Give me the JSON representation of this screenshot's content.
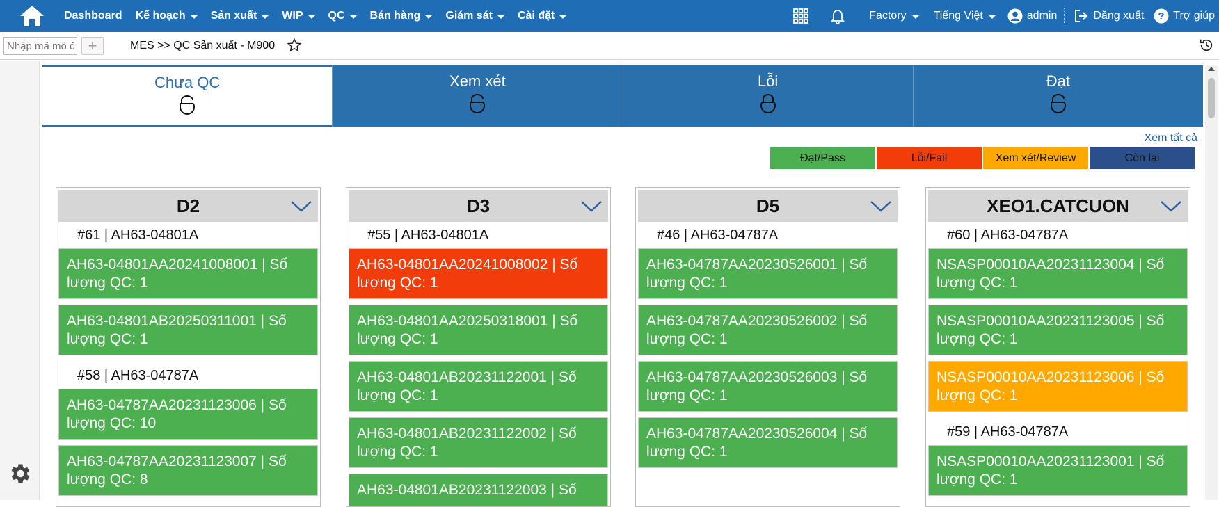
{
  "nav": {
    "items": [
      "Dashboard",
      "Kế hoạch",
      "Sản xuất",
      "WIP",
      "QC",
      "Bán hàng",
      "Giám sát",
      "Cài đặt"
    ],
    "factory": "Factory",
    "language": "Tiếng Việt",
    "user": "admin",
    "logout": "Đăng xuất",
    "help": "Trợ giúp"
  },
  "subbar": {
    "placeholder": "Nhập mã mô đ",
    "breadcrumb": "MES >> QC Sản xuất - M900"
  },
  "tabs": [
    {
      "label": "Chưa QC",
      "active": true
    },
    {
      "label": "Xem xét",
      "active": false
    },
    {
      "label": "Lỗi",
      "active": false
    },
    {
      "label": "Đạt",
      "active": false
    }
  ],
  "view_all": "Xem tất cả",
  "legend": [
    {
      "label": "Đạt/Pass",
      "color": "#4caf50"
    },
    {
      "label": "Lỗi/Fail",
      "color": "#f23c0a"
    },
    {
      "label": "Xem xét/Review",
      "color": "#ffa800"
    },
    {
      "label": "Còn lại",
      "color": "#2a4f8a"
    }
  ],
  "colors": {
    "pass": "#4caf50",
    "fail": "#f23c0a",
    "review": "#ffa800"
  },
  "columns": [
    {
      "title": "D2",
      "groups": [
        {
          "title": "#61 | AH63-04801A",
          "cards": [
            {
              "text": "AH63-04801AA20241008001 | Số lượng QC: 1",
              "status": "pass"
            },
            {
              "text": "AH63-04801AB20250311001 | Số lượng QC: 1",
              "status": "pass"
            }
          ]
        },
        {
          "title": "#58 | AH63-04787A",
          "cards": [
            {
              "text": "AH63-04787AA20231123006 | Số lượng QC: 10",
              "status": "pass"
            },
            {
              "text": "AH63-04787AA20231123007 | Số lượng QC: 8",
              "status": "pass"
            }
          ]
        }
      ]
    },
    {
      "title": "D3",
      "groups": [
        {
          "title": "#55 | AH63-04801A",
          "cards": [
            {
              "text": "AH63-04801AA20241008002 | Số lượng QC: 1",
              "status": "fail"
            },
            {
              "text": "AH63-04801AA20250318001 | Số lượng QC: 1",
              "status": "pass"
            },
            {
              "text": "AH63-04801AB20231122001 | Số lượng QC: 1",
              "status": "pass"
            },
            {
              "text": "AH63-04801AB20231122002 | Số lượng QC: 1",
              "status": "pass"
            },
            {
              "text": "AH63-04801AB20231122003 | Số",
              "status": "pass"
            }
          ]
        }
      ]
    },
    {
      "title": "D5",
      "groups": [
        {
          "title": "#46 | AH63-04787A",
          "cards": [
            {
              "text": "AH63-04787AA20230526001 | Số lượng QC: 1",
              "status": "pass"
            },
            {
              "text": "AH63-04787AA20230526002 | Số lượng QC: 1",
              "status": "pass"
            },
            {
              "text": "AH63-04787AA20230526003 | Số lượng QC: 1",
              "status": "pass"
            },
            {
              "text": "AH63-04787AA20230526004 | Số lượng QC: 1",
              "status": "pass"
            }
          ]
        }
      ]
    },
    {
      "title": "XEO1.CATCUON",
      "groups": [
        {
          "title": "#60 | AH63-04787A",
          "cards": [
            {
              "text": "NSASP00010AA20231123004 | Số lượng QC: 1",
              "status": "pass"
            },
            {
              "text": "NSASP00010AA20231123005 | Số lượng QC: 1",
              "status": "pass"
            },
            {
              "text": "NSASP00010AA20231123006 | Số lượng QC: 1",
              "status": "review"
            }
          ]
        },
        {
          "title": "#59 | AH63-04787A",
          "cards": [
            {
              "text": "NSASP00010AA20231123001 | Số lượng QC: 1",
              "status": "pass"
            }
          ]
        }
      ]
    }
  ]
}
